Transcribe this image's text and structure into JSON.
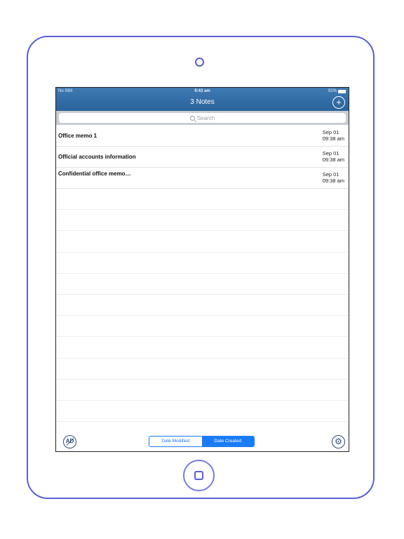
{
  "status_bar": {
    "carrier": "No SIM",
    "time": "9:43 am",
    "battery": "91%"
  },
  "nav": {
    "title": "3 Notes",
    "add_icon": "plus-icon"
  },
  "search": {
    "placeholder": "Search"
  },
  "notes": [
    {
      "title": "Office memo 1",
      "date": "Sep 01",
      "time": "09:38 am"
    },
    {
      "title": "Official accounts information",
      "date": "Sep 01",
      "time": "09:38 am"
    },
    {
      "title": "Confidential office memo…",
      "date": "Sep 01",
      "time": "09:38 am"
    }
  ],
  "toolbar": {
    "ad_label": "AD",
    "sort_modified": "Date Modified",
    "sort_created": "Date Created",
    "selected_sort": "Date Created",
    "settings_icon": "gear-icon"
  },
  "colors": {
    "frame": "#5a5fd6",
    "navbar": "#2a6299",
    "accent": "#1a7cf5"
  }
}
